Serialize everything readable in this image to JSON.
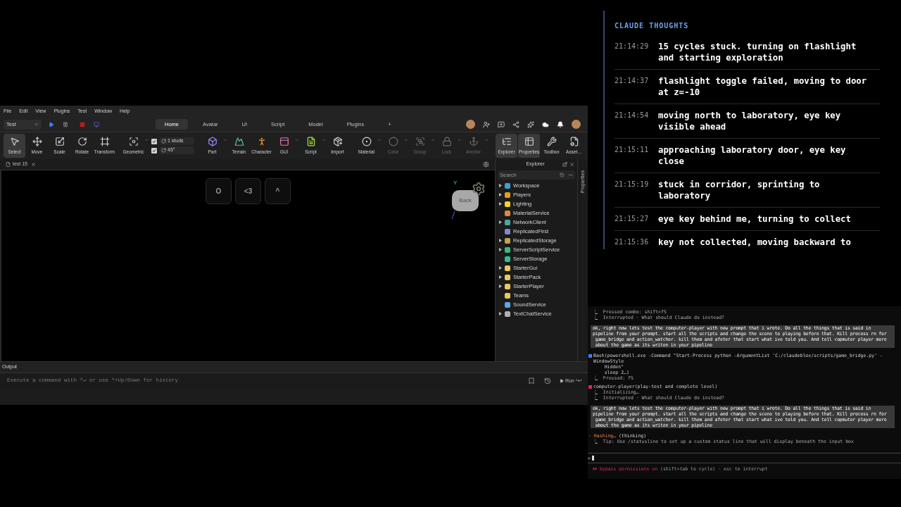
{
  "studio": {
    "menu": [
      "File",
      "Edit",
      "View",
      "Plugins",
      "Test",
      "Window",
      "Help"
    ],
    "mode": "Test",
    "tabs": [
      {
        "label": "Home",
        "selected": true
      },
      {
        "label": "Avatar",
        "selected": false
      },
      {
        "label": "UI",
        "selected": false
      },
      {
        "label": "Script",
        "selected": false
      },
      {
        "label": "Model",
        "selected": false
      },
      {
        "label": "Plugins",
        "selected": false
      },
      {
        "label": "+",
        "selected": false
      }
    ],
    "tool_groups": [
      [
        {
          "label": "Select",
          "selected": true,
          "disabled": false,
          "dropdown": false
        },
        {
          "label": "Move",
          "selected": false,
          "disabled": false,
          "dropdown": false
        },
        {
          "label": "Scale",
          "selected": false,
          "disabled": false,
          "dropdown": false
        },
        {
          "label": "Rotate",
          "selected": false,
          "disabled": false,
          "dropdown": false
        },
        {
          "label": "Transform",
          "selected": false,
          "disabled": false,
          "dropdown": false
        }
      ],
      [
        {
          "label": "Geometric",
          "selected": false,
          "disabled": false,
          "dropdown": true
        }
      ],
      [
        {
          "label": "Part",
          "selected": false,
          "disabled": false,
          "dropdown": true
        },
        {
          "label": "Terrain",
          "selected": false,
          "disabled": false,
          "dropdown": false
        },
        {
          "label": "Character",
          "selected": false,
          "disabled": false,
          "dropdown": false
        },
        {
          "label": "GUI",
          "selected": false,
          "disabled": false,
          "dropdown": true
        },
        {
          "label": "Script",
          "selected": false,
          "disabled": false,
          "dropdown": true
        },
        {
          "label": "Import",
          "selected": false,
          "disabled": false,
          "dropdown": false
        }
      ],
      [
        {
          "label": "Material",
          "selected": false,
          "disabled": false,
          "dropdown": true
        },
        {
          "label": "Color",
          "selected": false,
          "disabled": true,
          "dropdown": true
        },
        {
          "label": "Group",
          "selected": false,
          "disabled": true,
          "dropdown": true
        },
        {
          "label": "Lock",
          "selected": false,
          "disabled": true,
          "dropdown": true
        },
        {
          "label": "Anchor",
          "selected": false,
          "disabled": true,
          "dropdown": true
        }
      ],
      [
        {
          "label": "Explorer",
          "selected": true,
          "disabled": false,
          "dropdown": false
        },
        {
          "label": "Properties",
          "selected": true,
          "disabled": false,
          "dropdown": false
        },
        {
          "label": "Toolbox",
          "selected": false,
          "disabled": false,
          "dropdown": false
        },
        {
          "label": "Asset…",
          "selected": false,
          "disabled": false,
          "dropdown": false
        }
      ]
    ],
    "snaps": [
      {
        "value": "1 studs",
        "checked": true
      },
      {
        "value": "45°",
        "checked": true
      }
    ],
    "doc_tab": "test 15",
    "viewport_buttons": [
      "O",
      "<3",
      "^"
    ],
    "view_cube": {
      "label": "Back",
      "axis": "Y"
    },
    "explorer": {
      "title": "Explorer",
      "search_placeholder": "Search",
      "items": [
        {
          "name": "Workspace",
          "expandable": true,
          "color": "#3aa0d8"
        },
        {
          "name": "Players",
          "expandable": true,
          "color": "#e0a020"
        },
        {
          "name": "Lighting",
          "expandable": true,
          "color": "#f2d22e"
        },
        {
          "name": "MaterialService",
          "expandable": false,
          "color": "#e08a3a"
        },
        {
          "name": "NetworkClient",
          "expandable": true,
          "color": "#4aa8a0"
        },
        {
          "name": "ReplicatedFirst",
          "expandable": false,
          "color": "#7c8cc8"
        },
        {
          "name": "ReplicatedStorage",
          "expandable": true,
          "color": "#c8a24a"
        },
        {
          "name": "ServerScriptService",
          "expandable": true,
          "color": "#3cb878"
        },
        {
          "name": "ServerStorage",
          "expandable": false,
          "color": "#2fbf8f"
        },
        {
          "name": "StarterGui",
          "expandable": true,
          "color": "#e8c860"
        },
        {
          "name": "StarterPack",
          "expandable": true,
          "color": "#e8c860"
        },
        {
          "name": "StarterPlayer",
          "expandable": true,
          "color": "#e8c860"
        },
        {
          "name": "Teams",
          "expandable": false,
          "color": "#e8c860"
        },
        {
          "name": "SoundService",
          "expandable": false,
          "color": "#5ea8e0"
        },
        {
          "name": "TextChatService",
          "expandable": true,
          "color": "#b0b0b0"
        }
      ]
    },
    "properties_tab": "Properties",
    "output": {
      "title": "Output",
      "placeholder": "Execute a command with ^↵ or use ^+Up/Down for history",
      "run": "Run ^↵"
    }
  },
  "thoughts": {
    "title": "CLAUDE THOUGHTS",
    "entries": [
      {
        "time": "21:14:29",
        "text": "15 cycles stuck. turning on flashlight and starting exploration"
      },
      {
        "time": "21:14:37",
        "text": "flashlight toggle failed, moving to door at z=-10"
      },
      {
        "time": "21:14:54",
        "text": "moving north to laboratory, eye key visible ahead"
      },
      {
        "time": "21:15:11",
        "text": "approaching laboratory door, eye key close"
      },
      {
        "time": "21:15:19",
        "text": "stuck in corridor, sprinting to laboratory"
      },
      {
        "time": "21:15:27",
        "text": "eye key behind me, turning to collect"
      },
      {
        "time": "21:15:36",
        "text": "key not collected, moving backward to"
      }
    ]
  },
  "terminal": {
    "entries": [
      {
        "kind": "result",
        "mark": "⎿",
        "text": "Pressed combo: shift+f5"
      },
      {
        "kind": "result",
        "mark": "⎿",
        "text": "Interrupted · What should Claude do instead?"
      },
      {
        "kind": "prompt",
        "lines": [
          "ok, right now lets test the computer-player with new prompt that i wrote. Do all the things that is said in",
          "pipeline from your prompt. start all the scripts and change the scene to playing before that. Kill process rn for",
          " game_bridge and action_watcher. kill them and afeter that start what ive told you. And tell copmuter player more",
          " about the game as its writen in your pipeline"
        ]
      },
      {
        "kind": "call",
        "color": "#3b82f6",
        "lines": [
          "Bash(powershell.exe -Command \"Start-Process python -ArgumentList 'C:/claudeblox/scripts/game_bridge.py' -WindowStyle",
          "    Hidden\"",
          "    sleep 2…)"
        ]
      },
      {
        "kind": "result",
        "mark": "⎿",
        "text": "Pressed: f5"
      },
      {
        "kind": "call",
        "color": "#e0245e",
        "lines": [
          "computer-player(play-test and complete level)"
        ]
      },
      {
        "kind": "result",
        "mark": "⎿",
        "text": "Initializing…"
      },
      {
        "kind": "result",
        "mark": "⎿",
        "text": "Interrupted · What should Claude do instead?"
      },
      {
        "kind": "prompt",
        "lines": [
          "ok, right now lets test the computer-player with new prompt that i wrote. Do all the things that is said in",
          "pipeline from your prompt. start all the scripts and change the scene to playing before that. Kill process rn for",
          " game_bridge and action_watcher. kill them and afeter that start what ive told you. And tell copmuter player more",
          " about the game as its writen in your pipeline"
        ]
      },
      {
        "kind": "activity",
        "mark": "·",
        "verb": "Hashing…",
        "detail": "(thinking)"
      },
      {
        "kind": "result",
        "mark": "⎿",
        "text": "Tip: Use /statusline to set up a custom status line that will display beneath the input box"
      }
    ],
    "input_prompt": ">",
    "mode": "⏵⏵ bypass permissions on",
    "hint": "(shift+tab to cycle) · esc to interrupt"
  }
}
